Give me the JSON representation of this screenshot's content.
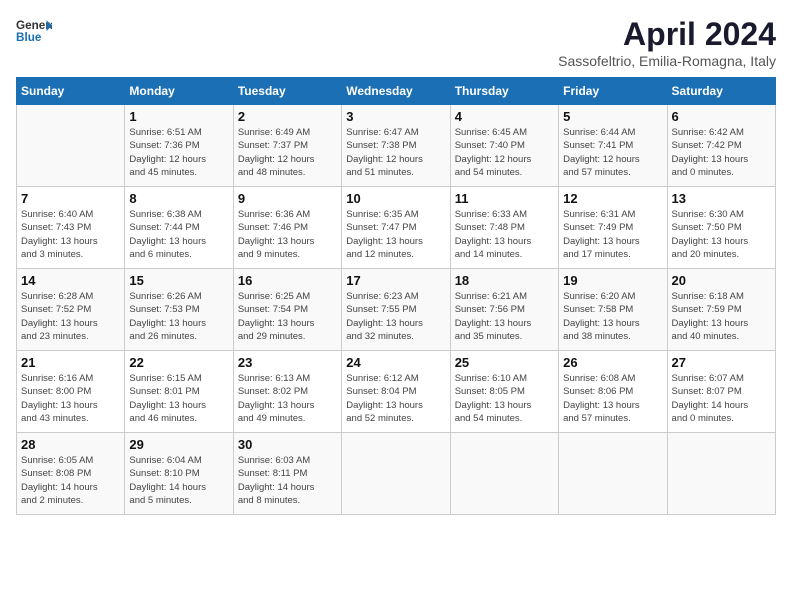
{
  "header": {
    "logo_general": "General",
    "logo_blue": "Blue",
    "month": "April 2024",
    "location": "Sassofeltrio, Emilia-Romagna, Italy"
  },
  "weekdays": [
    "Sunday",
    "Monday",
    "Tuesday",
    "Wednesday",
    "Thursday",
    "Friday",
    "Saturday"
  ],
  "weeks": [
    [
      {
        "day": "",
        "info": ""
      },
      {
        "day": "1",
        "info": "Sunrise: 6:51 AM\nSunset: 7:36 PM\nDaylight: 12 hours\nand 45 minutes."
      },
      {
        "day": "2",
        "info": "Sunrise: 6:49 AM\nSunset: 7:37 PM\nDaylight: 12 hours\nand 48 minutes."
      },
      {
        "day": "3",
        "info": "Sunrise: 6:47 AM\nSunset: 7:38 PM\nDaylight: 12 hours\nand 51 minutes."
      },
      {
        "day": "4",
        "info": "Sunrise: 6:45 AM\nSunset: 7:40 PM\nDaylight: 12 hours\nand 54 minutes."
      },
      {
        "day": "5",
        "info": "Sunrise: 6:44 AM\nSunset: 7:41 PM\nDaylight: 12 hours\nand 57 minutes."
      },
      {
        "day": "6",
        "info": "Sunrise: 6:42 AM\nSunset: 7:42 PM\nDaylight: 13 hours\nand 0 minutes."
      }
    ],
    [
      {
        "day": "7",
        "info": "Sunrise: 6:40 AM\nSunset: 7:43 PM\nDaylight: 13 hours\nand 3 minutes."
      },
      {
        "day": "8",
        "info": "Sunrise: 6:38 AM\nSunset: 7:44 PM\nDaylight: 13 hours\nand 6 minutes."
      },
      {
        "day": "9",
        "info": "Sunrise: 6:36 AM\nSunset: 7:46 PM\nDaylight: 13 hours\nand 9 minutes."
      },
      {
        "day": "10",
        "info": "Sunrise: 6:35 AM\nSunset: 7:47 PM\nDaylight: 13 hours\nand 12 minutes."
      },
      {
        "day": "11",
        "info": "Sunrise: 6:33 AM\nSunset: 7:48 PM\nDaylight: 13 hours\nand 14 minutes."
      },
      {
        "day": "12",
        "info": "Sunrise: 6:31 AM\nSunset: 7:49 PM\nDaylight: 13 hours\nand 17 minutes."
      },
      {
        "day": "13",
        "info": "Sunrise: 6:30 AM\nSunset: 7:50 PM\nDaylight: 13 hours\nand 20 minutes."
      }
    ],
    [
      {
        "day": "14",
        "info": "Sunrise: 6:28 AM\nSunset: 7:52 PM\nDaylight: 13 hours\nand 23 minutes."
      },
      {
        "day": "15",
        "info": "Sunrise: 6:26 AM\nSunset: 7:53 PM\nDaylight: 13 hours\nand 26 minutes."
      },
      {
        "day": "16",
        "info": "Sunrise: 6:25 AM\nSunset: 7:54 PM\nDaylight: 13 hours\nand 29 minutes."
      },
      {
        "day": "17",
        "info": "Sunrise: 6:23 AM\nSunset: 7:55 PM\nDaylight: 13 hours\nand 32 minutes."
      },
      {
        "day": "18",
        "info": "Sunrise: 6:21 AM\nSunset: 7:56 PM\nDaylight: 13 hours\nand 35 minutes."
      },
      {
        "day": "19",
        "info": "Sunrise: 6:20 AM\nSunset: 7:58 PM\nDaylight: 13 hours\nand 38 minutes."
      },
      {
        "day": "20",
        "info": "Sunrise: 6:18 AM\nSunset: 7:59 PM\nDaylight: 13 hours\nand 40 minutes."
      }
    ],
    [
      {
        "day": "21",
        "info": "Sunrise: 6:16 AM\nSunset: 8:00 PM\nDaylight: 13 hours\nand 43 minutes."
      },
      {
        "day": "22",
        "info": "Sunrise: 6:15 AM\nSunset: 8:01 PM\nDaylight: 13 hours\nand 46 minutes."
      },
      {
        "day": "23",
        "info": "Sunrise: 6:13 AM\nSunset: 8:02 PM\nDaylight: 13 hours\nand 49 minutes."
      },
      {
        "day": "24",
        "info": "Sunrise: 6:12 AM\nSunset: 8:04 PM\nDaylight: 13 hours\nand 52 minutes."
      },
      {
        "day": "25",
        "info": "Sunrise: 6:10 AM\nSunset: 8:05 PM\nDaylight: 13 hours\nand 54 minutes."
      },
      {
        "day": "26",
        "info": "Sunrise: 6:08 AM\nSunset: 8:06 PM\nDaylight: 13 hours\nand 57 minutes."
      },
      {
        "day": "27",
        "info": "Sunrise: 6:07 AM\nSunset: 8:07 PM\nDaylight: 14 hours\nand 0 minutes."
      }
    ],
    [
      {
        "day": "28",
        "info": "Sunrise: 6:05 AM\nSunset: 8:08 PM\nDaylight: 14 hours\nand 2 minutes."
      },
      {
        "day": "29",
        "info": "Sunrise: 6:04 AM\nSunset: 8:10 PM\nDaylight: 14 hours\nand 5 minutes."
      },
      {
        "day": "30",
        "info": "Sunrise: 6:03 AM\nSunset: 8:11 PM\nDaylight: 14 hours\nand 8 minutes."
      },
      {
        "day": "",
        "info": ""
      },
      {
        "day": "",
        "info": ""
      },
      {
        "day": "",
        "info": ""
      },
      {
        "day": "",
        "info": ""
      }
    ]
  ]
}
